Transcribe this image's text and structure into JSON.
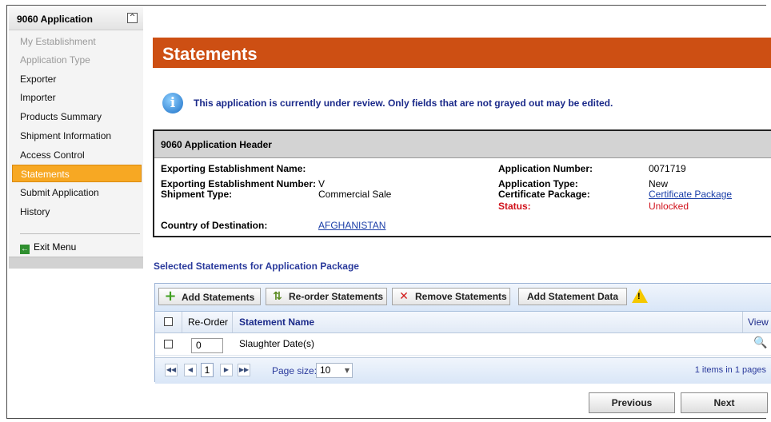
{
  "sidebar": {
    "title": "9060 Application",
    "collapse_glyph": "^",
    "items": [
      {
        "label": "My Establishment",
        "state": "disabled"
      },
      {
        "label": "Application Type",
        "state": "disabled"
      },
      {
        "label": "Exporter",
        "state": "normal"
      },
      {
        "label": "Importer",
        "state": "normal"
      },
      {
        "label": "Products Summary",
        "state": "normal"
      },
      {
        "label": "Shipment Information",
        "state": "normal"
      },
      {
        "label": "Access Control",
        "state": "normal"
      },
      {
        "label": "Statements",
        "state": "active"
      },
      {
        "label": "Submit Application",
        "state": "normal"
      },
      {
        "label": "History",
        "state": "normal"
      }
    ],
    "exit_label": "Exit Menu"
  },
  "page": {
    "title": "Statements",
    "info_message": "This application is currently under review. Only fields that are not grayed out may be edited."
  },
  "header_box": {
    "title": "9060 Application Header",
    "exporting_establishment_name_label": "Exporting Establishment Name:",
    "exporting_establishment_name_value": "",
    "exporting_establishment_number_label": "Exporting Establishment Number:",
    "exporting_establishment_number_value": "V",
    "shipment_type_label": "Shipment Type:",
    "shipment_type_value": "Commercial Sale",
    "country_label": "Country of Destination:",
    "country_value": "AFGHANISTAN",
    "application_number_label": "Application Number:",
    "application_number_value": "0071719",
    "application_type_label": "Application Type:",
    "application_type_value": "New",
    "certificate_package_label": "Certificate Package:",
    "certificate_package_value": "Certificate Package",
    "status_label": "Status:",
    "status_value": "Unlocked"
  },
  "statements": {
    "section_title": "Selected Statements for Application Package",
    "toolbar": {
      "add_label": "Add Statements",
      "reorder_label": "Re-order Statements",
      "remove_label": "Remove Statements",
      "add_data_label": "Add Statement Data"
    },
    "columns": {
      "reorder": "Re-Order",
      "name": "Statement Name",
      "view": "View"
    },
    "rows": [
      {
        "order": "0",
        "name": "Slaughter Date(s)"
      }
    ],
    "pager": {
      "current_page": "1",
      "page_size_label": "Page size:",
      "page_size": "10",
      "info": "1 items in 1 pages"
    }
  },
  "nav": {
    "previous_label": "Previous",
    "next_label": "Next"
  },
  "colors": {
    "accent_orange": "#cd4f13",
    "active_item": "#f7a823",
    "status_red": "#d0121b",
    "link_blue": "#1a3ea8"
  }
}
